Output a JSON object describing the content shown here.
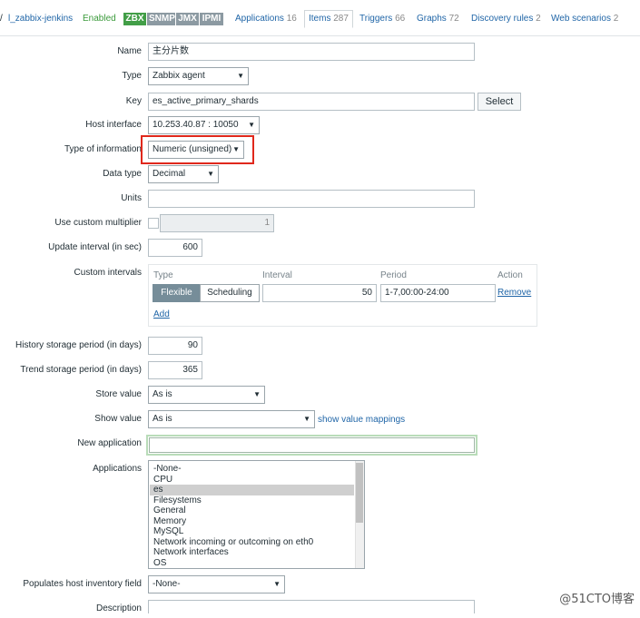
{
  "header": {
    "slash": "/",
    "host_link": "l_zabbix-jenkins",
    "status": "Enabled",
    "badges": [
      "ZBX",
      "SNMP",
      "JMX",
      "IPMI"
    ],
    "tabs": [
      {
        "label": "Applications",
        "count": "16"
      },
      {
        "label": "Items",
        "count": "287"
      },
      {
        "label": "Triggers",
        "count": "66"
      },
      {
        "label": "Graphs",
        "count": "72"
      },
      {
        "label": "Discovery rules",
        "count": "2"
      },
      {
        "label": "Web scenarios",
        "count": "2"
      }
    ]
  },
  "form": {
    "name": {
      "label": "Name",
      "value": "主分片数"
    },
    "type": {
      "label": "Type",
      "value": "Zabbix agent"
    },
    "key": {
      "label": "Key",
      "value": "es_active_primary_shards",
      "button": "Select"
    },
    "host_interface": {
      "label": "Host interface",
      "value": "10.253.40.87 : 10050"
    },
    "type_of_info": {
      "label": "Type of information",
      "value": "Numeric (unsigned)"
    },
    "data_type": {
      "label": "Data type",
      "value": "Decimal"
    },
    "units": {
      "label": "Units",
      "value": ""
    },
    "custom_multiplier": {
      "label": "Use custom multiplier",
      "value": "1",
      "checked": false
    },
    "update_interval": {
      "label": "Update interval (in sec)",
      "value": "600"
    },
    "custom_intervals": {
      "label": "Custom intervals",
      "headers": {
        "type": "Type",
        "interval": "Interval",
        "period": "Period",
        "action": "Action"
      },
      "row": {
        "flexible": "Flexible",
        "scheduling": "Scheduling",
        "interval": "50",
        "period": "1-7,00:00-24:00",
        "remove": "Remove"
      },
      "add": "Add"
    },
    "history": {
      "label": "History storage period (in days)",
      "value": "90"
    },
    "trends": {
      "label": "Trend storage period (in days)",
      "value": "365"
    },
    "store_value": {
      "label": "Store value",
      "value": "As is"
    },
    "show_value": {
      "label": "Show value",
      "value": "As is",
      "link": "show value mappings"
    },
    "new_application": {
      "label": "New application",
      "value": ""
    },
    "applications": {
      "label": "Applications",
      "options": [
        "-None-",
        "CPU",
        "es",
        "Filesystems",
        "General",
        "Memory",
        "MySQL",
        "Network incoming or outcoming on eth0",
        "Network interfaces",
        "OS"
      ],
      "selected": "es"
    },
    "inventory": {
      "label": "Populates host inventory field",
      "value": "-None-"
    },
    "description": {
      "label": "Description",
      "value": ""
    }
  },
  "watermark": "@51CTO博客",
  "colors": {
    "link": "#1f65a7",
    "enabled": "#3a9a3a",
    "zbx_badge": "#429e47",
    "highlight": "#e0281c",
    "segment_active": "#768d99"
  }
}
